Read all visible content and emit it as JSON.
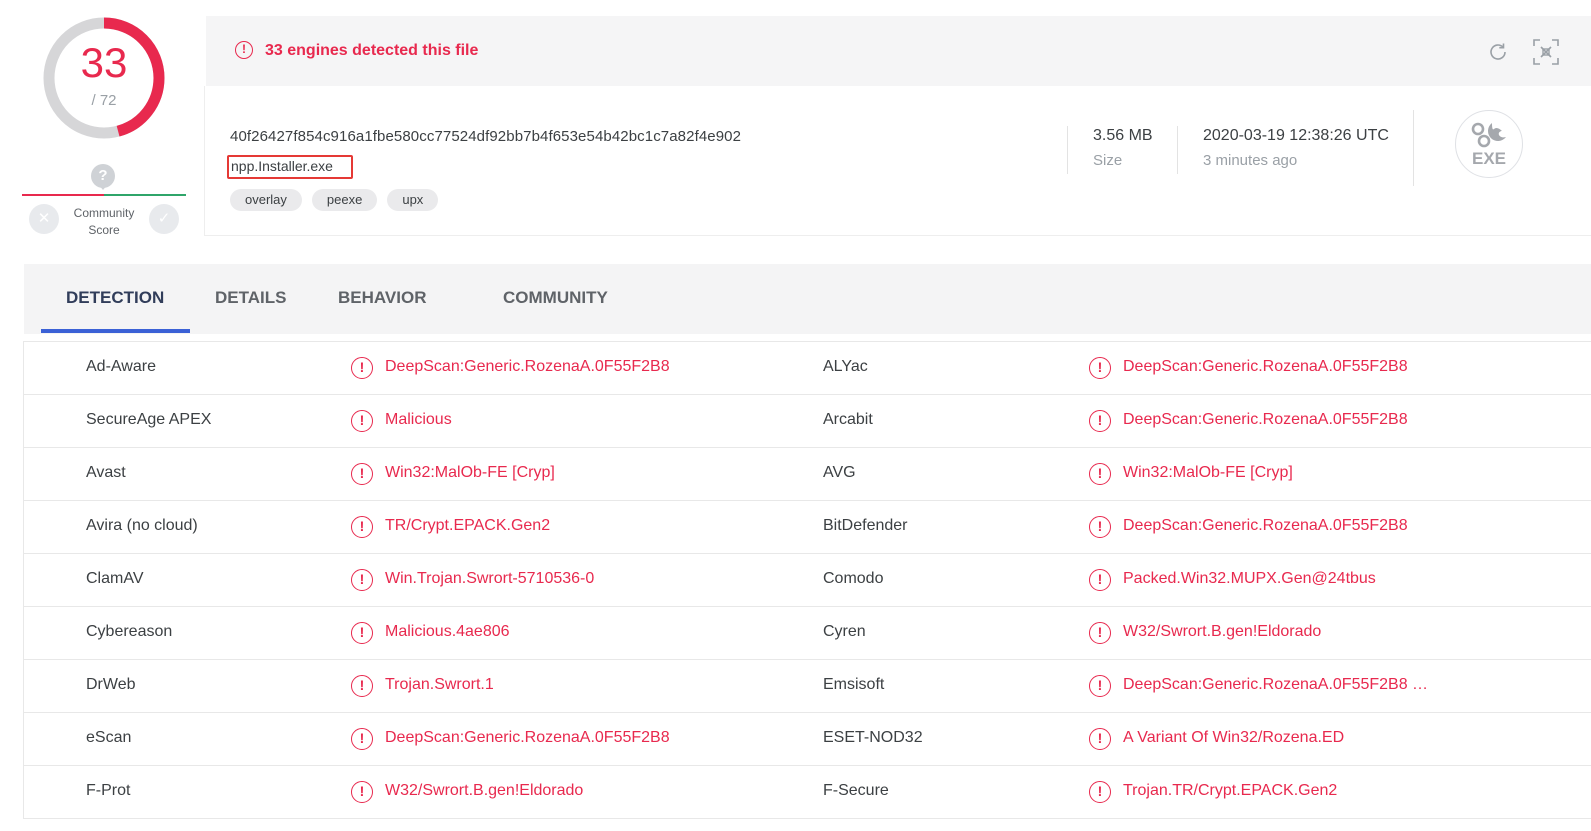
{
  "score": {
    "detected": "33",
    "total": "/ 72",
    "detected_fraction": 0.4583
  },
  "community": {
    "question": "?",
    "label_line1": "Community",
    "label_line2": "Score"
  },
  "alert": {
    "icon": "!",
    "message": "33 engines detected this file"
  },
  "file": {
    "hash": "40f26427f854c916a1fbe580cc77524df92bb7b4f653e54b42bc1c7a82f4e902",
    "name": "npp.Installer.exe",
    "tags": [
      "overlay",
      "peexe",
      "upx"
    ],
    "size_value": "3.56 MB",
    "size_label": "Size",
    "date_value": "2020-03-19 12:38:26 UTC",
    "date_label": "3 minutes ago",
    "type_icon": "exe-file-icon",
    "type_text": "EXE"
  },
  "tabs": [
    "DETECTION",
    "DETAILS",
    "BEHAVIOR",
    "COMMUNITY"
  ],
  "active_tab": "DETECTION",
  "colors": {
    "accent_red": "#e8294e",
    "tab_underline": "#3b61d6",
    "positive_green": "#2fa56a"
  },
  "detections": [
    {
      "engine_left": "Ad-Aware",
      "result_left": "DeepScan:Generic.RozenaA.0F55F2B8",
      "engine_right": "ALYac",
      "result_right": "DeepScan:Generic.RozenaA.0F55F2B8"
    },
    {
      "engine_left": "SecureAge APEX",
      "result_left": "Malicious",
      "engine_right": "Arcabit",
      "result_right": "DeepScan:Generic.RozenaA.0F55F2B8"
    },
    {
      "engine_left": "Avast",
      "result_left": "Win32:MalOb-FE [Cryp]",
      "engine_right": "AVG",
      "result_right": "Win32:MalOb-FE [Cryp]"
    },
    {
      "engine_left": "Avira (no cloud)",
      "result_left": "TR/Crypt.EPACK.Gen2",
      "engine_right": "BitDefender",
      "result_right": "DeepScan:Generic.RozenaA.0F55F2B8"
    },
    {
      "engine_left": "ClamAV",
      "result_left": "Win.Trojan.Swrort-5710536-0",
      "engine_right": "Comodo",
      "result_right": "Packed.Win32.MUPX.Gen@24tbus"
    },
    {
      "engine_left": "Cybereason",
      "result_left": "Malicious.4ae806",
      "engine_right": "Cyren",
      "result_right": "W32/Swrort.B.gen!Eldorado"
    },
    {
      "engine_left": "DrWeb",
      "result_left": "Trojan.Swrort.1",
      "engine_right": "Emsisoft",
      "result_right": "DeepScan:Generic.RozenaA.0F55F2B8 …"
    },
    {
      "engine_left": "eScan",
      "result_left": "DeepScan:Generic.RozenaA.0F55F2B8",
      "engine_right": "ESET-NOD32",
      "result_right": "A Variant Of Win32/Rozena.ED"
    },
    {
      "engine_left": "F-Prot",
      "result_left": "W32/Swrort.B.gen!Eldorado",
      "engine_right": "F-Secure",
      "result_right": "Trojan.TR/Crypt.EPACK.Gen2"
    }
  ]
}
